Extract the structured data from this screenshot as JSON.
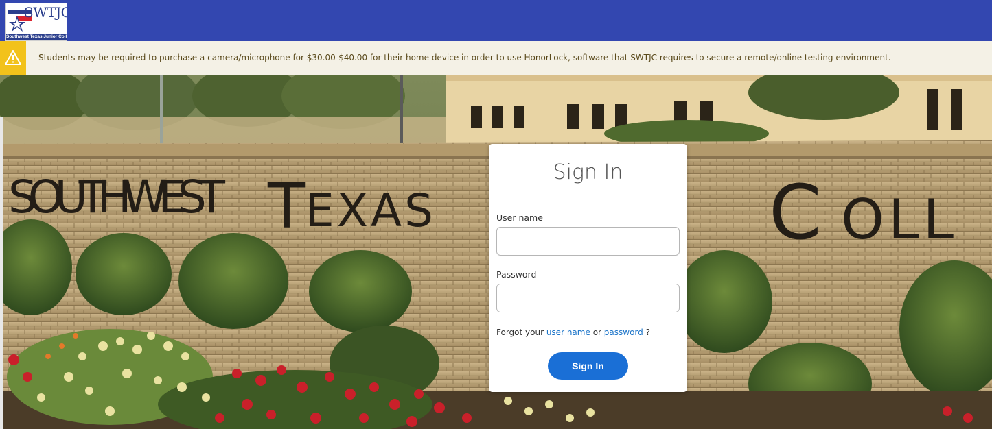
{
  "header": {
    "logo_text": "SWTJC",
    "logo_subtext": "Southwest Texas Junior College",
    "brand_color": "#3347b0"
  },
  "alert": {
    "icon": "warning-icon",
    "message": "Students may be required to purchase a camera/microphone for $30.00-$40.00 for their home device in order to use HonorLock, software that SWTJC requires to secure a remote/online testing environment.",
    "icon_color": "#f2c21b"
  },
  "hero": {
    "sign_text_left": "SOUTHWEST TEXAS",
    "sign_text_right": "COLL"
  },
  "signin": {
    "title": "Sign In",
    "username_label": "User name",
    "username_value": "",
    "password_label": "Password",
    "password_value": "",
    "forgot_prefix": "Forgot your",
    "forgot_username_link": "user name",
    "forgot_or": "or",
    "forgot_password_link": "password",
    "forgot_suffix": "?",
    "button_label": "Sign In",
    "button_color": "#1a6fd6"
  }
}
